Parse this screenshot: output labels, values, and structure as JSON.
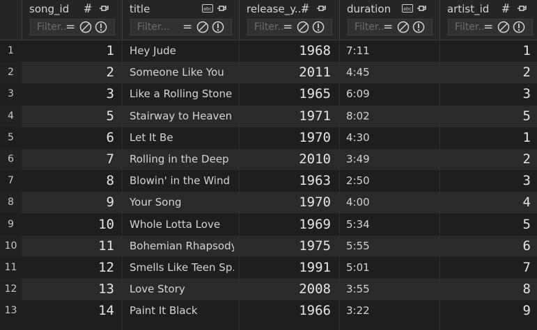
{
  "columns": [
    {
      "name": "song_id",
      "type_icon": "hash-icon",
      "filter_placeholder": "Filter..."
    },
    {
      "name": "title",
      "type_icon": "text-type-icon",
      "filter_placeholder": "Filter..."
    },
    {
      "name": "release_y...",
      "type_icon": "hash-icon",
      "filter_placeholder": "Filter..."
    },
    {
      "name": "duration",
      "type_icon": "text-type-icon",
      "filter_placeholder": "Filter..."
    },
    {
      "name": "artist_id",
      "type_icon": "hash-icon",
      "filter_placeholder": "Filter..."
    }
  ],
  "type_glyphs": {
    "hash": "#",
    "abc": "abc",
    "equals": "="
  },
  "rows": [
    {
      "n": "1",
      "song_id": "1",
      "title": "Hey Jude",
      "release_year": "1968",
      "duration": "7:11",
      "artist_id": "1"
    },
    {
      "n": "2",
      "song_id": "2",
      "title": "Someone Like You",
      "release_year": "2011",
      "duration": "4:45",
      "artist_id": "2"
    },
    {
      "n": "3",
      "song_id": "3",
      "title": "Like a Rolling Stone",
      "release_year": "1965",
      "duration": "6:09",
      "artist_id": "3"
    },
    {
      "n": "4",
      "song_id": "5",
      "title": "Stairway to Heaven",
      "release_year": "1971",
      "duration": "8:02",
      "artist_id": "5"
    },
    {
      "n": "5",
      "song_id": "6",
      "title": "Let It Be",
      "release_year": "1970",
      "duration": "4:30",
      "artist_id": "1"
    },
    {
      "n": "6",
      "song_id": "7",
      "title": "Rolling in the Deep",
      "release_year": "2010",
      "duration": "3:49",
      "artist_id": "2"
    },
    {
      "n": "7",
      "song_id": "8",
      "title": "Blowin' in the Wind",
      "release_year": "1963",
      "duration": "2:50",
      "artist_id": "3"
    },
    {
      "n": "8",
      "song_id": "9",
      "title": "Your Song",
      "release_year": "1970",
      "duration": "4:00",
      "artist_id": "4"
    },
    {
      "n": "9",
      "song_id": "10",
      "title": "Whole Lotta Love",
      "release_year": "1969",
      "duration": "5:34",
      "artist_id": "5"
    },
    {
      "n": "10",
      "song_id": "11",
      "title": "Bohemian Rhapsody",
      "release_year": "1975",
      "duration": "5:55",
      "artist_id": "6"
    },
    {
      "n": "11",
      "song_id": "12",
      "title": "Smells Like Teen Sp...",
      "release_year": "1991",
      "duration": "5:01",
      "artist_id": "7"
    },
    {
      "n": "12",
      "song_id": "13",
      "title": "Love Story",
      "release_year": "2008",
      "duration": "3:55",
      "artist_id": "8"
    },
    {
      "n": "13",
      "song_id": "14",
      "title": "Paint It Black",
      "release_year": "1966",
      "duration": "3:22",
      "artist_id": "9"
    }
  ]
}
